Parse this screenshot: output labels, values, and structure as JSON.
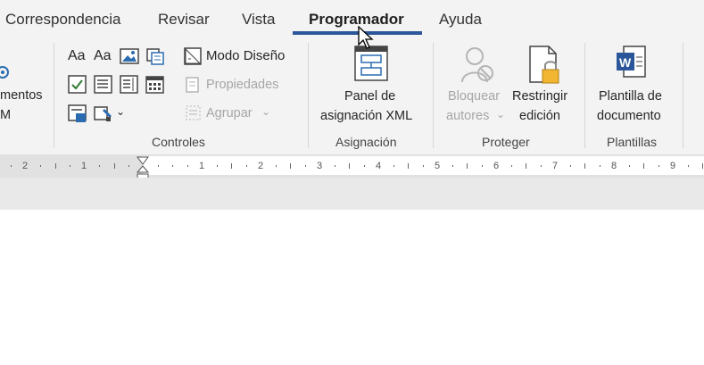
{
  "tabs": [
    {
      "label": "Correspondencia",
      "active": false
    },
    {
      "label": "Revisar",
      "active": false
    },
    {
      "label": "Vista",
      "active": false
    },
    {
      "label": "Programador",
      "active": true
    },
    {
      "label": "Ayuda",
      "active": false
    }
  ],
  "ribbon": {
    "left_group": {
      "line1": "mentos",
      "line2": "M"
    },
    "controles": {
      "label": "Controles",
      "aa_rich": "Aa",
      "aa_plain": "Aa",
      "design_mode": "Modo Diseño",
      "properties": "Propiedades",
      "group": "Agrupar"
    },
    "asignacion": {
      "label": "Asignación",
      "xml_panel_line1": "Panel de",
      "xml_panel_line2": "asignación XML"
    },
    "proteger": {
      "label": "Proteger",
      "block_line1": "Bloquear",
      "block_line2": "autores",
      "restrict_line1": "Restringir",
      "restrict_line2": "edición"
    },
    "plantillas": {
      "label": "Plantillas",
      "template_line1": "Plantilla de",
      "template_line2": "documento"
    }
  },
  "ruler": {
    "left_ticks": [
      "2",
      "1"
    ],
    "right_ticks": [
      "1",
      "2",
      "3",
      "4",
      "5",
      "6",
      "7",
      "8",
      "9"
    ]
  },
  "colors": {
    "accent": "#2b579a",
    "ribbon_bg": "#f3f3f3",
    "disabled_text": "#a6a6a6"
  }
}
